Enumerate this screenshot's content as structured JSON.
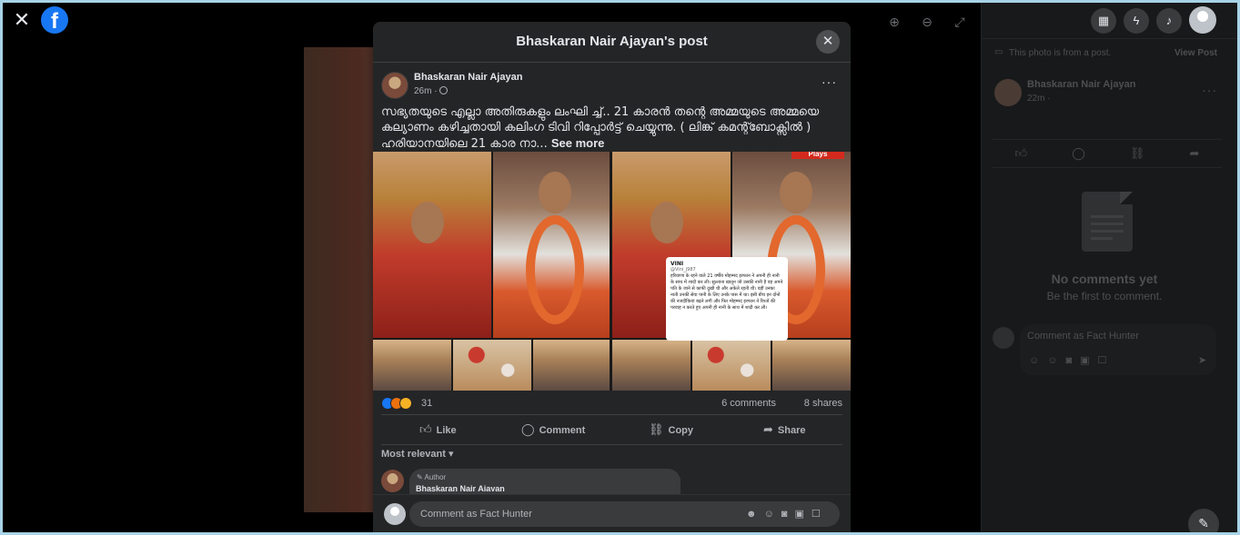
{
  "window": {
    "close_icon": "close-icon",
    "logo_icon": "facebook-logo",
    "logo_text": "f"
  },
  "viewer": {
    "zoom_in_icon": "zoom-in-icon",
    "zoom_out_icon": "zoom-out-icon",
    "fullscreen_icon": "fullscreen-icon"
  },
  "right_panel": {
    "menu_icon": "grid-menu-icon",
    "messenger_icon": "messenger-icon",
    "notifications_icon": "bell-icon",
    "from_post_text": "This photo is from a post.",
    "view_post_label": "View Post",
    "author": "Bhaskaran Nair Ajayan",
    "time": "22m ·",
    "no_comments_title": "No comments yet",
    "no_comments_sub": "Be the first to comment.",
    "comment_placeholder": "Comment as Fact Hunter"
  },
  "modal": {
    "title": "Bhaskaran Nair Ajayan's post",
    "post": {
      "author": "Bhaskaran Nair Ajayan",
      "time": "26m ·",
      "text": "സഭ്യതയുടെ എല്ലാ അതിരുകളും ലംഘി ച്ച്.. 21 കാരൻ തന്റെ അമ്മയുടെ അമ്മയെ കല്യാണം കഴിച്ചതായി കലിംഗ ടിവി റിപ്പോർട്ട് ചെയ്യുന്നു. ( ലിങ്ക് കമന്റ്ബോക്സിൽ ) ഹരിയാനയിലെ 21 കാര നാ...",
      "see_more": "See more"
    },
    "image": {
      "plays_label": "Plays",
      "tweet_user": "VINI",
      "tweet_handle": "@Vini_j987",
      "tweet_text": "हरियाणा के रहने वाले 21 वर्षीय मोहम्मद इरफान ने अपनी ही नानी के साथ में शादी कर ली। सुल्ताना खातून जो उसकी नानी है वह अपने पति के जाने से काफी दुखी थी और अकेले रहती थी। वहीं उनका नाती उनकी सेवा पानी के लिए उनके पास में था। इसी बीच इन दोनों की नजदीकियां बढ़ने लगी और फिर मोहम्मद इरफान ने रिश्तों की परवाह न करते हुए अपनी ही नानी के साथ में शादी कर ली।"
    },
    "stats": {
      "reaction_count": "31",
      "comments": "6 comments",
      "shares": "8 shares"
    },
    "actions": {
      "like": "Like",
      "comment": "Comment",
      "copy": "Copy",
      "share": "Share"
    },
    "sort_label": "Most relevant",
    "first_comment": {
      "badge": "Author",
      "name": "Bhaskaran Nair Ajayan"
    },
    "composer_placeholder": "Comment as Fact Hunter"
  }
}
